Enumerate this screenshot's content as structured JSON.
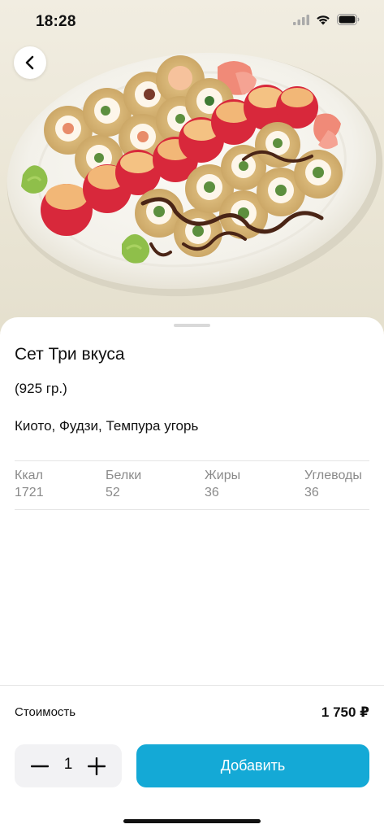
{
  "status_bar": {
    "time": "18:28"
  },
  "product": {
    "title": "Сет Три вкуса",
    "weight": "(925 гр.)",
    "description": "Киото, Фудзи, Темпура угорь"
  },
  "nutrition": [
    {
      "label": "Ккал",
      "value": "1721"
    },
    {
      "label": "Белки",
      "value": "52"
    },
    {
      "label": "Жиры",
      "value": "36"
    },
    {
      "label": "Углеводы",
      "value": "36"
    }
  ],
  "footer": {
    "cost_label": "Стоимость",
    "cost_value": "1 750 ₽",
    "quantity": "1",
    "add_label": "Добавить"
  },
  "colors": {
    "accent": "#14a9d6",
    "stepper_bg": "#f2f2f4",
    "muted_text": "#8a8a8a"
  },
  "icons": {
    "back": "chevron-left-icon",
    "minus": "minus-icon",
    "plus": "plus-icon",
    "signal": "cellular-signal-icon",
    "wifi": "wifi-icon",
    "battery": "battery-icon"
  }
}
